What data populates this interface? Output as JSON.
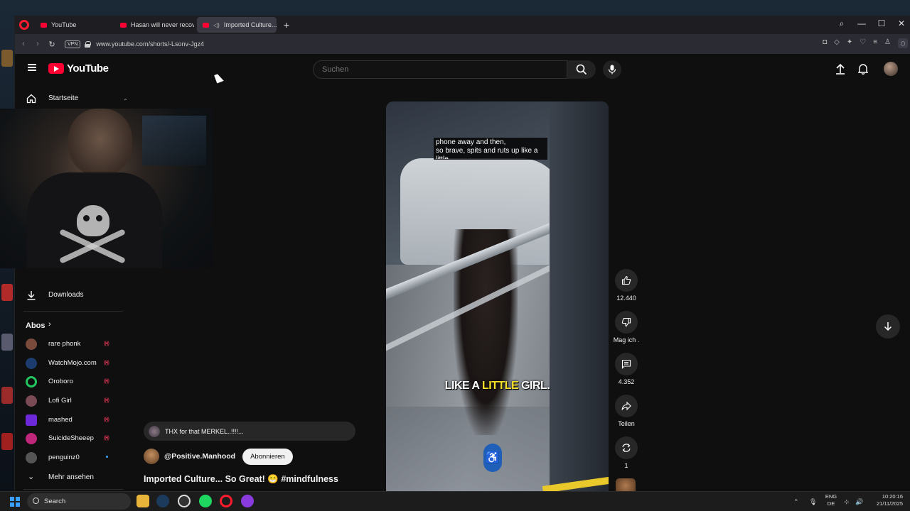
{
  "browser": {
    "tabs": [
      {
        "label": "YouTube"
      },
      {
        "label": "Hasan will never recover f"
      },
      {
        "label": "Imported Culture... So"
      }
    ],
    "new_tab_label": "+",
    "url": "www.youtube.com/shorts/-Lsonv-Jgz4",
    "vpn_label": "VPN"
  },
  "youtube": {
    "logo_text": "YouTube",
    "search_placeholder": "Suchen",
    "sidebar": {
      "home_label": "Startseite",
      "downloads_label": "Downloads",
      "subscriptions_title": "Abos",
      "subscriptions": [
        {
          "name": "rare phonk",
          "avatar_color": "#7a4a3a",
          "status": "live"
        },
        {
          "name": "WatchMojo.com",
          "avatar_color": "#1d3c6e",
          "status": "live"
        },
        {
          "name": "Oroboro",
          "avatar_color": "#22c55e",
          "status": "live"
        },
        {
          "name": "Lofi Girl",
          "avatar_color": "#7a4a55",
          "status": "live"
        },
        {
          "name": "mashed",
          "avatar_color": "#6d28d9",
          "status": "live"
        },
        {
          "name": "SuicideSheeep",
          "avatar_color": "#c0267a",
          "status": "live"
        },
        {
          "name": "penguinz0",
          "avatar_color": "#555555",
          "status": "new"
        }
      ],
      "show_more_label": "Mehr ansehen"
    },
    "short": {
      "caption_top": [
        "phone away and then,",
        "so brave, spits and ruts up like a",
        "little"
      ],
      "caption_main_pre": "LIKE A ",
      "caption_main_highlight": "LITTLE",
      "caption_main_post": " GIRL.",
      "like_count": "12.440",
      "dislike_label": "Mag ich .",
      "comment_count": "4.352",
      "share_label": "Teilen",
      "remix_count": "1",
      "pinned_comment": "THX for that MERKEL..!!!!...",
      "channel_name": "@Positive.Manhood",
      "subscribe_label": "Abonnieren",
      "title": "Imported Culture... So Great! 😁 #mindfulness"
    }
  },
  "taskbar": {
    "search_label": "Search",
    "lang_top": "ENG",
    "lang_bottom": "DE",
    "time": "10:20:16",
    "date": "21/11/2025"
  },
  "colors": {
    "youtube_red": "#ff0033",
    "opera_red": "#ff1b2d",
    "page_bg": "#0f0f0f",
    "caption_highlight": "#f5e02a"
  }
}
